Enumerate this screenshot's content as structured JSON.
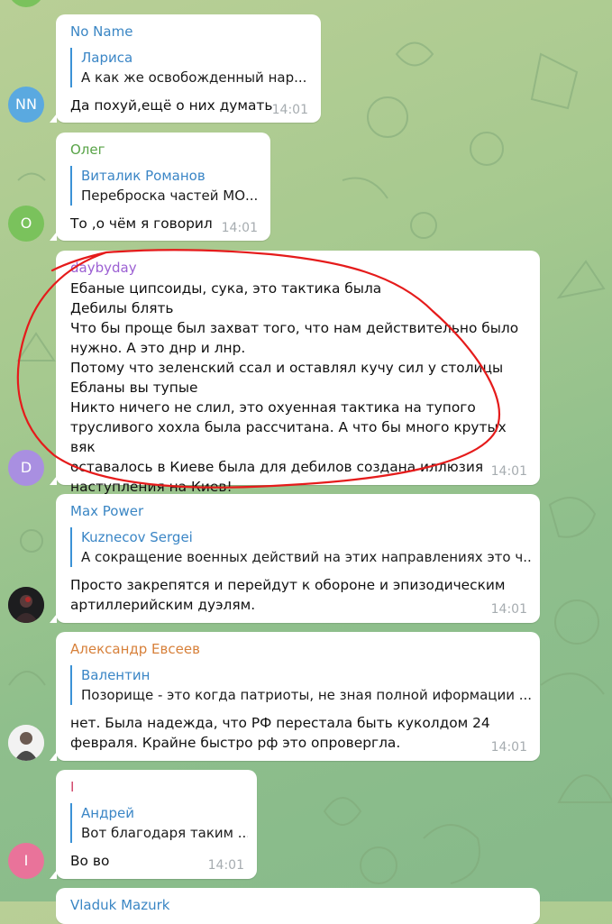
{
  "messages": [
    {
      "sender": "No Name",
      "sender_color": "#3a86c4",
      "reply": {
        "name": "Лариса",
        "text": "А как же освобожденный нар..."
      },
      "body": "Да похуй,ещё о них думать",
      "time": "14:01",
      "avatar": {
        "initials": "NN",
        "color": "#5aa9e0"
      }
    },
    {
      "sender": "Олег",
      "sender_color": "#58a347",
      "reply": {
        "name": "Виталик Романов",
        "text": "Переброска частей МО..."
      },
      "body": "То ,о чём я говорил",
      "time": "14:01",
      "avatar": {
        "initials": "О",
        "color": "#7ac25c"
      }
    },
    {
      "sender": "daybyday",
      "sender_color": "#9c60d3",
      "body_lines": [
        "Ебаные ципсоиды, сука, это тактика была",
        "Дебилы блять",
        "Что бы проще был захват того, что нам действительно было",
        "нужно. А это днр и лнр.",
        "Потому что зеленский ссал и оставлял кучу сил у столицы",
        "Ебланы вы тупые",
        "Никто ничего не слил, это охуенная тактика на тупого",
        "трусливого хохла была рассчитана. А что бы много крутых вяк",
        "оставалось в Киеве была для дебилов создана иллюзия",
        "наступления на Киев!"
      ],
      "time": "14:01",
      "avatar": {
        "initials": "D",
        "color": "#a98fe1"
      }
    },
    {
      "sender": "Max Power",
      "sender_color": "#3a86c4",
      "reply": {
        "name": "Kuznecov Sergei",
        "text": "А сокращение военных действий на этих направлениях это ч..."
      },
      "body_lines": [
        "Просто закрепятся и перейдут к обороне и эпизодическим",
        "артиллерийским дуэлям."
      ],
      "time": "14:01",
      "avatar": {
        "type": "photo"
      }
    },
    {
      "sender": "Александр Евсеев",
      "sender_color": "#d7803a",
      "reply": {
        "name": "Валентин",
        "text": "Позорище - это когда патриоты, не зная полной иформации ..."
      },
      "body_lines": [
        "нет. Была надежда, что РФ перестала быть куколдом 24",
        "февраля. Крайне быстро рф это опровергла."
      ],
      "time": "14:01",
      "avatar": {
        "type": "photo"
      }
    },
    {
      "sender": "I",
      "sender_color": "#d1466a",
      "reply": {
        "name": "Андрей",
        "text": "Вот благодаря таким ..."
      },
      "body": "Во во",
      "time": "14:01",
      "avatar": {
        "initials": "I",
        "color": "#e9739a"
      }
    },
    {
      "sender": "Vladuk Mazurk",
      "sender_color": "#3a86c4"
    }
  ]
}
